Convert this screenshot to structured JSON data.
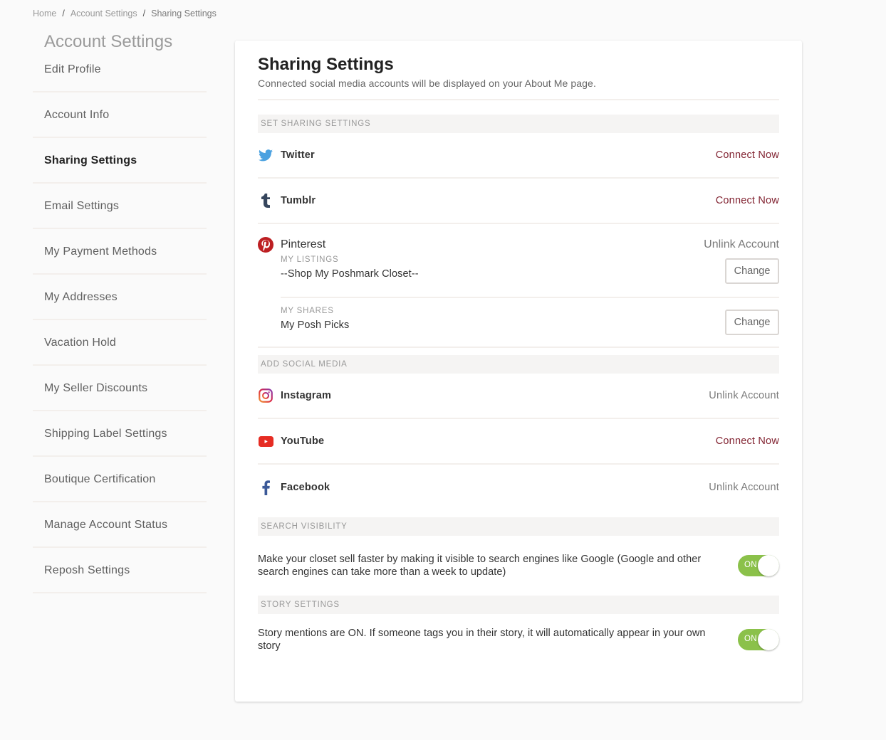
{
  "breadcrumb": {
    "items": [
      "Home",
      "Account Settings",
      "Sharing Settings"
    ],
    "separator": "/"
  },
  "sidebar": {
    "title": "Account Settings",
    "items": [
      {
        "label": "Edit Profile",
        "active": false
      },
      {
        "label": "Account Info",
        "active": false
      },
      {
        "label": "Sharing Settings",
        "active": true
      },
      {
        "label": "Email Settings",
        "active": false
      },
      {
        "label": "My Payment Methods",
        "active": false
      },
      {
        "label": "My Addresses",
        "active": false
      },
      {
        "label": "Vacation Hold",
        "active": false
      },
      {
        "label": "My Seller Discounts",
        "active": false
      },
      {
        "label": "Shipping Label Settings",
        "active": false
      },
      {
        "label": "Boutique Certification",
        "active": false
      },
      {
        "label": "Manage Account Status",
        "active": false
      },
      {
        "label": "Reposh Settings",
        "active": false
      }
    ]
  },
  "main": {
    "title": "Sharing Settings",
    "subtitle": "Connected social media accounts will be displayed on your About Me page.",
    "sections": {
      "set_sharing": {
        "heading": "SET SHARING SETTINGS",
        "twitter": {
          "name": "Twitter",
          "icon": "twitter-icon",
          "action": "Connect Now"
        },
        "tumblr": {
          "name": "Tumblr",
          "icon": "tumblr-icon",
          "action": "Connect Now"
        },
        "pinterest": {
          "name": "Pinterest",
          "icon": "pinterest-icon",
          "action": "Unlink Account",
          "listings_label": "MY LISTINGS",
          "listings_value": "--Shop My Poshmark Closet--",
          "shares_label": "MY SHARES",
          "shares_value": "My Posh Picks",
          "change_label": "Change"
        }
      },
      "add_social": {
        "heading": "ADD SOCIAL MEDIA",
        "instagram": {
          "name": "Instagram",
          "icon": "instagram-icon",
          "action": "Unlink Account"
        },
        "youtube": {
          "name": "YouTube",
          "icon": "youtube-icon",
          "action": "Connect Now"
        },
        "facebook": {
          "name": "Facebook",
          "icon": "facebook-icon",
          "action": "Unlink Account"
        }
      },
      "search_visibility": {
        "heading": "SEARCH VISIBILITY",
        "text": "Make your closet sell faster by making it visible to search engines like Google (Google and other search engines can take more than a week to update)",
        "toggle_label": "ON",
        "toggle_on": true
      },
      "story_settings": {
        "heading": "STORY SETTINGS",
        "text": "Story mentions are ON. If someone tags you in their story, it will automatically appear in your own story",
        "toggle_label": "ON",
        "toggle_on": true
      }
    }
  },
  "colors": {
    "connect": "#822432",
    "toggle_on": "#8bc14a",
    "twitter": "#4aa1e0",
    "tumblr": "#36465d",
    "pinterest": "#bd1f22",
    "youtube": "#e62c23",
    "facebook": "#3b5998"
  }
}
